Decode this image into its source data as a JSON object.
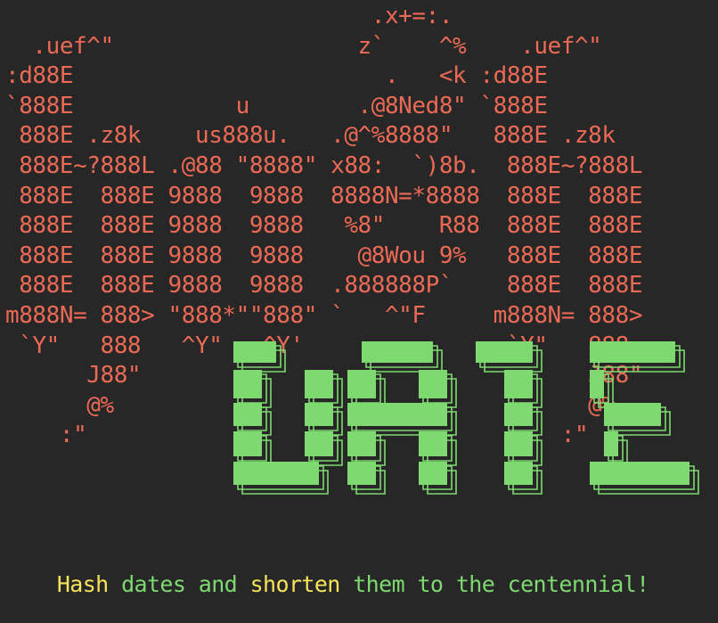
{
  "banner": {
    "ascii_lines": [
      "                           .x+=:.",
      "  .uef^\"                  z`    ^%    .uef^\"",
      ":d88E                       .   <k :d88E",
      "`888E            u        .@8Ned8\" `888E",
      " 888E .z8k    us888u.   .@^%8888\"   888E .z8k",
      " 888E~?888L .@88 \"8888\" x88:  `)8b.  888E~?888L",
      " 888E  888E 9888  9888  8888N=*8888  888E  888E",
      " 888E  888E 9888  9888   %8\"    R88  888E  888E",
      " 888E  888E 9888  9888    @8Wou 9%   888E  888E",
      " 888E  888E 9888  9888  .888888P`    888E  888E",
      "m888N= 888> \"888*\"\"888\" `   ^\"F     m888N= 888>",
      " `Y\"   888   ^Y\"   ^Y'               `Y\"   888",
      "      J88\"                                 J88\"",
      "      @%                                   @%",
      "    :\"                                   :\""
    ],
    "ascii_color": "#ec6a55"
  },
  "logo": {
    "text": "DATE",
    "fill_color": "#7ed970",
    "shadow_color": "#7ed970"
  },
  "tagline": {
    "segments": [
      {
        "text": "Hash",
        "color": "#f5e35a"
      },
      {
        "text": " dates and ",
        "color": "#7ed970"
      },
      {
        "text": "shorten",
        "color": "#f5e35a"
      },
      {
        "text": " them to the centennial!",
        "color": "#7ed970"
      }
    ]
  },
  "colors": {
    "background": "#272727"
  }
}
